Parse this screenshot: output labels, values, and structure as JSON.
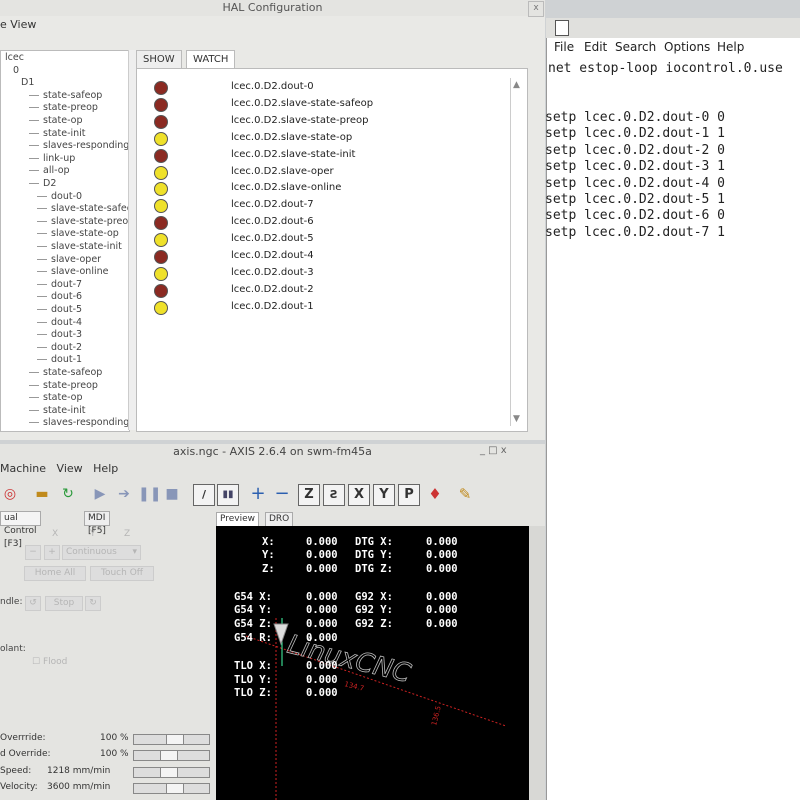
{
  "hal": {
    "title": "HAL Configuration",
    "close": "x",
    "menu": "e View",
    "tabs": [
      "SHOW",
      "WATCH"
    ],
    "tree": [
      {
        "label": "lcec",
        "indent": 0
      },
      {
        "label": "0",
        "indent": 1
      },
      {
        "label": "D1",
        "indent": 2
      },
      {
        "label": "state-safeop",
        "indent": 3
      },
      {
        "label": "state-preop",
        "indent": 3
      },
      {
        "label": "state-op",
        "indent": 3
      },
      {
        "label": "state-init",
        "indent": 3
      },
      {
        "label": "slaves-responding",
        "indent": 3
      },
      {
        "label": "link-up",
        "indent": 3
      },
      {
        "label": "all-op",
        "indent": 3
      },
      {
        "label": "D2",
        "indent": 3
      },
      {
        "label": "dout-0",
        "indent": 4
      },
      {
        "label": "slave-state-safeop",
        "indent": 4
      },
      {
        "label": "slave-state-preop",
        "indent": 4
      },
      {
        "label": "slave-state-op",
        "indent": 4
      },
      {
        "label": "slave-state-init",
        "indent": 4
      },
      {
        "label": "slave-oper",
        "indent": 4
      },
      {
        "label": "slave-online",
        "indent": 4
      },
      {
        "label": "dout-7",
        "indent": 4
      },
      {
        "label": "dout-6",
        "indent": 4
      },
      {
        "label": "dout-5",
        "indent": 4
      },
      {
        "label": "dout-4",
        "indent": 4
      },
      {
        "label": "dout-3",
        "indent": 4
      },
      {
        "label": "dout-2",
        "indent": 4
      },
      {
        "label": "dout-1",
        "indent": 4
      },
      {
        "label": "state-safeop",
        "indent": 3
      },
      {
        "label": "state-preop",
        "indent": 3
      },
      {
        "label": "state-op",
        "indent": 3
      },
      {
        "label": "state-init",
        "indent": 3
      },
      {
        "label": "slaves-responding",
        "indent": 3
      }
    ],
    "watch": [
      {
        "label": "lcec.0.D2.dout-0",
        "state": "red"
      },
      {
        "label": "lcec.0.D2.slave-state-safeop",
        "state": "red"
      },
      {
        "label": "lcec.0.D2.slave-state-preop",
        "state": "red"
      },
      {
        "label": "lcec.0.D2.slave-state-op",
        "state": "yellow"
      },
      {
        "label": "lcec.0.D2.slave-state-init",
        "state": "red"
      },
      {
        "label": "lcec.0.D2.slave-oper",
        "state": "yellow"
      },
      {
        "label": "lcec.0.D2.slave-online",
        "state": "yellow"
      },
      {
        "label": "lcec.0.D2.dout-7",
        "state": "yellow"
      },
      {
        "label": "lcec.0.D2.dout-6",
        "state": "red"
      },
      {
        "label": "lcec.0.D2.dout-5",
        "state": "yellow"
      },
      {
        "label": "lcec.0.D2.dout-4",
        "state": "red"
      },
      {
        "label": "lcec.0.D2.dout-3",
        "state": "yellow"
      },
      {
        "label": "lcec.0.D2.dout-2",
        "state": "red"
      },
      {
        "label": "lcec.0.D2.dout-1",
        "state": "yellow"
      }
    ],
    "colors": {
      "red": "#8b2a22",
      "yellow": "#efe12a"
    }
  },
  "editor": {
    "menu": [
      "File",
      "Edit",
      "Search",
      "Options",
      "Help"
    ],
    "first_line": "net estop-loop iocontrol.0.use",
    "lines": [
      "setp lcec.0.D2.dout-0 0",
      "setp lcec.0.D2.dout-1 1",
      "setp lcec.0.D2.dout-2 0",
      "setp lcec.0.D2.dout-3 1",
      "setp lcec.0.D2.dout-4 0",
      "setp lcec.0.D2.dout-5 1",
      "setp lcec.0.D2.dout-6 0",
      "setp lcec.0.D2.dout-7 1"
    ]
  },
  "axis": {
    "title": "axis.ngc - AXIS 2.6.4 on swm-fm45a",
    "title_buttons": "_ □ x",
    "menu": [
      "Machine",
      "View",
      "Help"
    ],
    "left_tabs": [
      "ual Control [F3]",
      "MDI [F5]"
    ],
    "preview_tabs": [
      "Preview",
      "DRO"
    ],
    "ghost": {
      "axes": [
        "X",
        "Y",
        "Z"
      ],
      "continuous": "Continuous",
      "home_all": "Home All",
      "touch_off": "Touch Off",
      "spindle": "ndle:",
      "stop": "Stop",
      "coolant": "olant:",
      "flood": "Flood"
    },
    "status": [
      {
        "label": "Overrride:",
        "value": "100 %",
        "knob": 0.55
      },
      {
        "label": "d Override:",
        "value": "100 %",
        "knob": 0.45
      },
      {
        "label": "Speed:",
        "value": "1218 mm/min",
        "knob": 0.45
      },
      {
        "label": "Velocity:",
        "value": "3600 mm/min",
        "knob": 0.55
      }
    ],
    "dro": [
      {
        "a": "X:",
        "av": "0.000",
        "b": "DTG X:",
        "bv": "0.000"
      },
      {
        "a": "Y:",
        "av": "0.000",
        "b": "DTG Y:",
        "bv": "0.000"
      },
      {
        "a": "Z:",
        "av": "0.000",
        "b": "DTG Z:",
        "bv": "0.000"
      },
      {
        "a": "G54 X:",
        "av": "0.000",
        "b": "G92 X:",
        "bv": "0.000"
      },
      {
        "a": "G54 Y:",
        "av": "0.000",
        "b": "G92 Y:",
        "bv": "0.000"
      },
      {
        "a": "G54 Z:",
        "av": "0.000",
        "b": "G92 Z:",
        "bv": "0.000"
      },
      {
        "a": "G54 R:",
        "av": "0.000",
        "b": "",
        "bv": ""
      },
      {
        "a": "TLO X:",
        "av": "0.000",
        "b": "",
        "bv": ""
      },
      {
        "a": "TLO Y:",
        "av": "0.000",
        "b": "",
        "bv": ""
      },
      {
        "a": "TLO Z:",
        "av": "0.000",
        "b": "",
        "bv": ""
      }
    ],
    "logo_text": "LinuxCNC",
    "dim_labels": [
      "134.7",
      "136.5"
    ]
  }
}
